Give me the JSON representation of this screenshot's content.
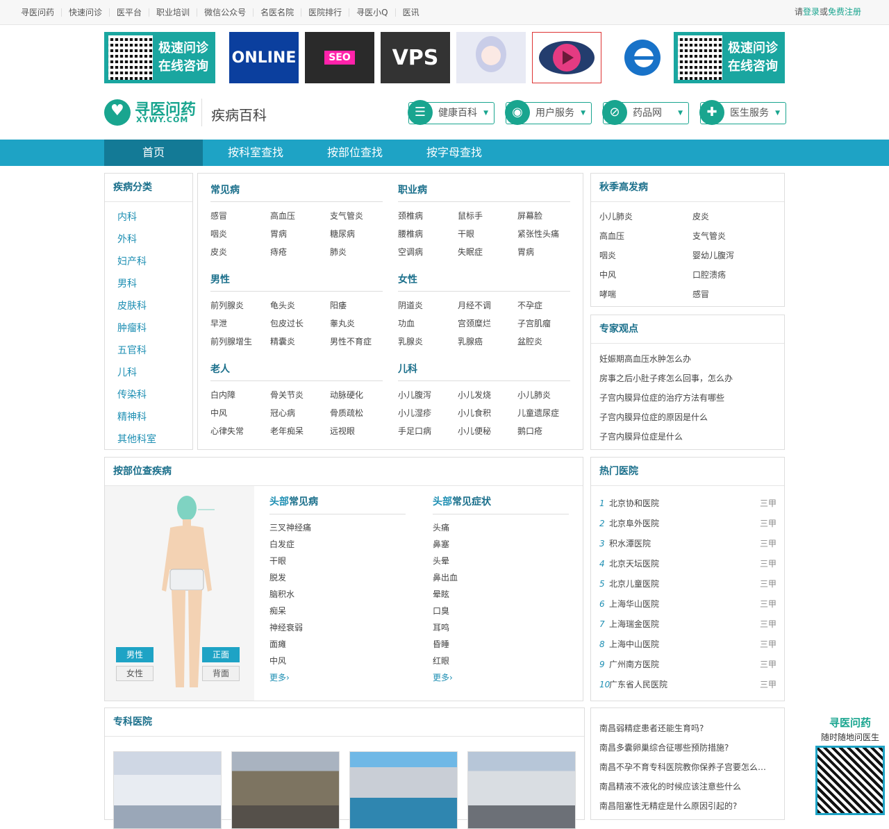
{
  "topbar": {
    "links": [
      "寻医问药",
      "快速问诊",
      "医平台",
      "职业培训",
      "微信公众号",
      "名医名院",
      "医院排行",
      "寻医小Q",
      "医讯"
    ],
    "login_pre": "请",
    "login": "登录",
    "or": "或",
    "register": "免费注册"
  },
  "ads": {
    "qr_line1": "极速问诊",
    "qr_line2": "在线咨询",
    "img1": "ONLINE",
    "img2": "SEO",
    "img3": "VPS"
  },
  "logo": {
    "name": "寻医问药",
    "domain": "XYWY.COM",
    "section": "疾病百科"
  },
  "services": [
    "健康百科",
    "用户服务",
    "药品网",
    "医生服务"
  ],
  "nav": [
    "首页",
    "按科室查找",
    "按部位查找",
    "按字母查找"
  ],
  "categories": {
    "title": "疾病分类",
    "items": [
      "内科",
      "外科",
      "妇产科",
      "男科",
      "皮肤科",
      "肿瘤科",
      "五官科",
      "儿科",
      "传染科",
      "精神科",
      "其他科室"
    ]
  },
  "diseases": {
    "common": {
      "title": "常见病",
      "items": [
        "感冒",
        "高血压",
        "支气管炎",
        "咽炎",
        "胃病",
        "糖尿病",
        "皮炎",
        "痔疮",
        "肺炎"
      ]
    },
    "occupational": {
      "title": "职业病",
      "items": [
        "颈椎病",
        "鼠标手",
        "屏幕脸",
        "腰椎病",
        "干眼",
        "紧张性头痛",
        "空调病",
        "失眠症",
        "胃病"
      ]
    },
    "male": {
      "title": "男性",
      "items": [
        "前列腺炎",
        "龟头炎",
        "阳痿",
        "早泄",
        "包皮过长",
        "睾丸炎",
        "前列腺增生",
        "精囊炎",
        "男性不育症"
      ]
    },
    "female": {
      "title": "女性",
      "items": [
        "阴道炎",
        "月经不调",
        "不孕症",
        "功血",
        "宫颈糜烂",
        "子宫肌瘤",
        "乳腺炎",
        "乳腺癌",
        "盆腔炎"
      ]
    },
    "elderly": {
      "title": "老人",
      "items": [
        "白内障",
        "骨关节炎",
        "动脉硬化",
        "中风",
        "冠心病",
        "骨质疏松",
        "心律失常",
        "老年痴呆",
        "远视眼"
      ]
    },
    "children": {
      "title": "儿科",
      "items": [
        "小儿腹泻",
        "小儿发烧",
        "小儿肺炎",
        "小儿湿疹",
        "小儿食积",
        "儿童遗尿症",
        "手足口病",
        "小儿便秘",
        "鹅口疮"
      ]
    }
  },
  "seasonal": {
    "title": "秋季高发病",
    "items": [
      "小儿肺炎",
      "皮炎",
      "高血压",
      "支气管炎",
      "咽炎",
      "婴幼儿腹泻",
      "中风",
      "口腔溃疡",
      "哮喘",
      "感冒"
    ]
  },
  "expert": {
    "title": "专家观点",
    "items": [
      "妊娠期高血压水肿怎么办",
      "房事之后小肚子疼怎么回事，怎么办",
      "子宫内膜异位症的治疗方法有哪些",
      "子宫内膜异位症的原因是什么",
      "子宫内膜异位症是什么"
    ]
  },
  "bodypart": {
    "title": "按部位查疾病",
    "male": "男性",
    "female": "女性",
    "front": "正面",
    "back": "背面",
    "head_prefix": "头部",
    "common_title": "常见病",
    "symptom_title": "常见症状",
    "common": [
      "三叉神经痛",
      "白发症",
      "干眼",
      "脱发",
      "脑积水",
      "痴呆",
      "神经衰弱",
      "面瘫",
      "中风"
    ],
    "symptoms": [
      "头痛",
      "鼻塞",
      "头晕",
      "鼻出血",
      "晕眩",
      "口臭",
      "耳鸣",
      "昏睡",
      "红眼"
    ],
    "more": "更多"
  },
  "hospitals": {
    "title": "热门医院",
    "items": [
      {
        "n": "1",
        "name": "北京协和医院",
        "grade": "三甲"
      },
      {
        "n": "2",
        "name": "北京阜外医院",
        "grade": "三甲"
      },
      {
        "n": "3",
        "name": "积水潭医院",
        "grade": "三甲"
      },
      {
        "n": "4",
        "name": "北京天坛医院",
        "grade": "三甲"
      },
      {
        "n": "5",
        "name": "北京儿童医院",
        "grade": "三甲"
      },
      {
        "n": "6",
        "name": "上海华山医院",
        "grade": "三甲"
      },
      {
        "n": "7",
        "name": "上海瑞金医院",
        "grade": "三甲"
      },
      {
        "n": "8",
        "name": "上海中山医院",
        "grade": "三甲"
      },
      {
        "n": "9",
        "name": "广州南方医院",
        "grade": "三甲"
      },
      {
        "n": "10",
        "name": "广东省人民医院",
        "grade": "三甲"
      }
    ]
  },
  "specialty": {
    "title": "专科医院"
  },
  "news": [
    "南昌弱精症患者还能生育吗?",
    "南昌多囊卵巢综合征哪些预防措施?",
    "南昌不孕不育专科医院教你保养子宫要怎么…",
    "南昌精液不液化的时候应该注意些什么",
    "南昌阻塞性无精症是什么原因引起的?"
  ],
  "floatqr": {
    "title": "寻医问药",
    "sub": "随时随地问医生"
  },
  "colors": {
    "brand": "#19a58f",
    "nav": "#1ea3c5",
    "nav_active": "#137a96",
    "link": "#1e8fb3",
    "heading": "#1a6f8b"
  }
}
